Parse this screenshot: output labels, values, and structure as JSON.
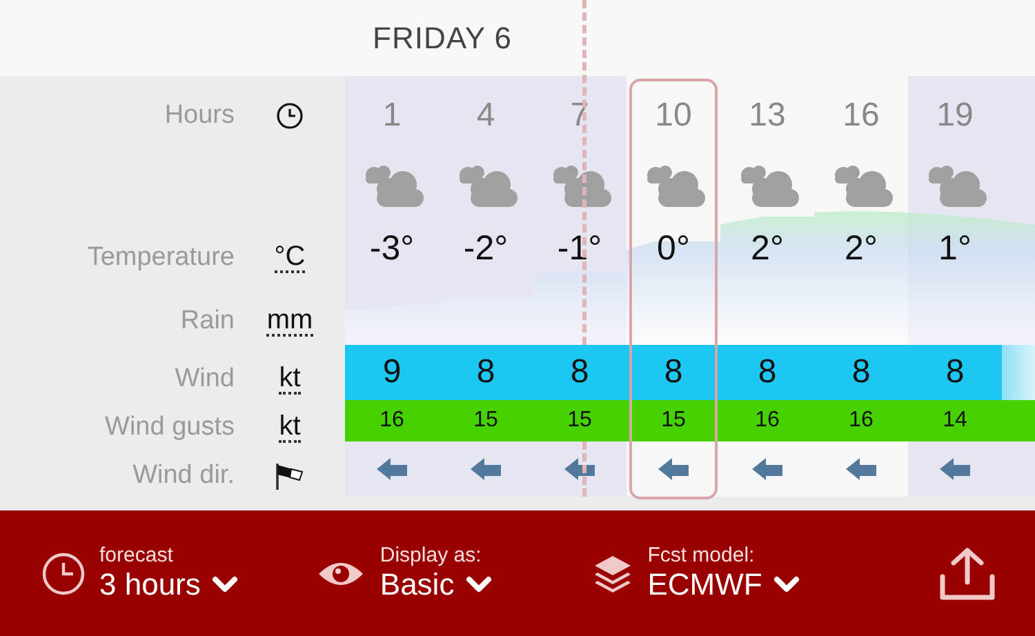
{
  "day_header": "FRIDAY 6",
  "rows": [
    {
      "label": "Hours",
      "kind": "clock"
    },
    {
      "label": "Temperature",
      "kind": "unit",
      "unit": "°C"
    },
    {
      "label": "Rain",
      "kind": "unit",
      "unit": "mm"
    },
    {
      "label": "Wind",
      "kind": "unit",
      "unit": "kt"
    },
    {
      "label": "Wind gusts",
      "kind": "unit",
      "unit": "kt"
    },
    {
      "label": "Wind dir.",
      "kind": "windsock"
    }
  ],
  "columns": [
    {
      "hour": "1",
      "temp": "-3°",
      "wind": "9",
      "gust": "16",
      "night": true,
      "selected": false
    },
    {
      "hour": "4",
      "temp": "-2°",
      "wind": "8",
      "gust": "15",
      "night": true,
      "selected": false
    },
    {
      "hour": "7",
      "temp": "-1°",
      "wind": "8",
      "gust": "15",
      "night": true,
      "selected": false
    },
    {
      "hour": "10",
      "temp": "0°",
      "wind": "8",
      "gust": "15",
      "night": false,
      "selected": true
    },
    {
      "hour": "13",
      "temp": "2°",
      "wind": "8",
      "gust": "16",
      "night": false,
      "selected": false
    },
    {
      "hour": "16",
      "temp": "2°",
      "wind": "8",
      "gust": "16",
      "night": false,
      "selected": false
    },
    {
      "hour": "19",
      "temp": "1°",
      "wind": "8",
      "gust": "14",
      "night": true,
      "selected": false
    }
  ],
  "toolbar": [
    {
      "kind": "clock",
      "label": "forecast",
      "value": "3 hours"
    },
    {
      "kind": "eye",
      "label": "Display as:",
      "value": "Basic"
    },
    {
      "kind": "layers",
      "label": "Fcst model:",
      "value": "ECMWF"
    }
  ]
}
